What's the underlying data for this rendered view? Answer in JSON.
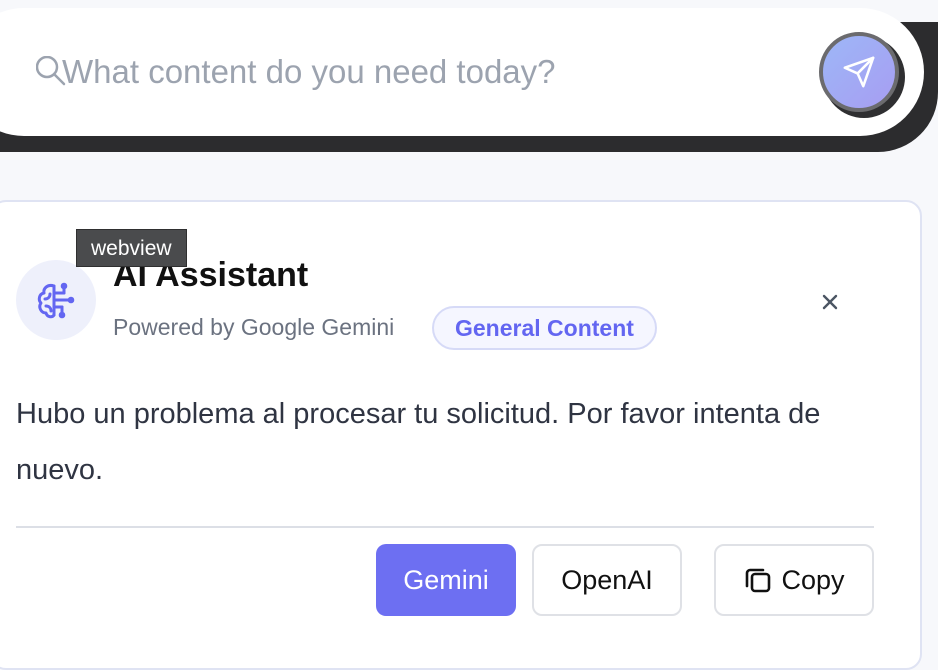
{
  "search": {
    "placeholder": "What content do you need today?",
    "value": ""
  },
  "tooltip": {
    "text": "webview"
  },
  "assistant": {
    "title": "AI Assistant",
    "powered_by": "Powered by Google Gemini",
    "badge": "General Content",
    "close_label": "×"
  },
  "message": {
    "text": "Hubo un problema al procesar tu solicitud. Por favor intenta de nuevo."
  },
  "actions": {
    "gemini_label": "Gemini",
    "openai_label": "OpenAI",
    "copy_label": "Copy"
  },
  "colors": {
    "accent": "#6d6ff2",
    "badge_text": "#6366f1",
    "send_gradient_start": "#9db7f7",
    "send_gradient_end": "#a79df2"
  },
  "icons": {
    "search": "search-icon",
    "send": "send-icon",
    "brain": "brain-icon",
    "close": "close-icon",
    "copy": "copy-icon"
  }
}
